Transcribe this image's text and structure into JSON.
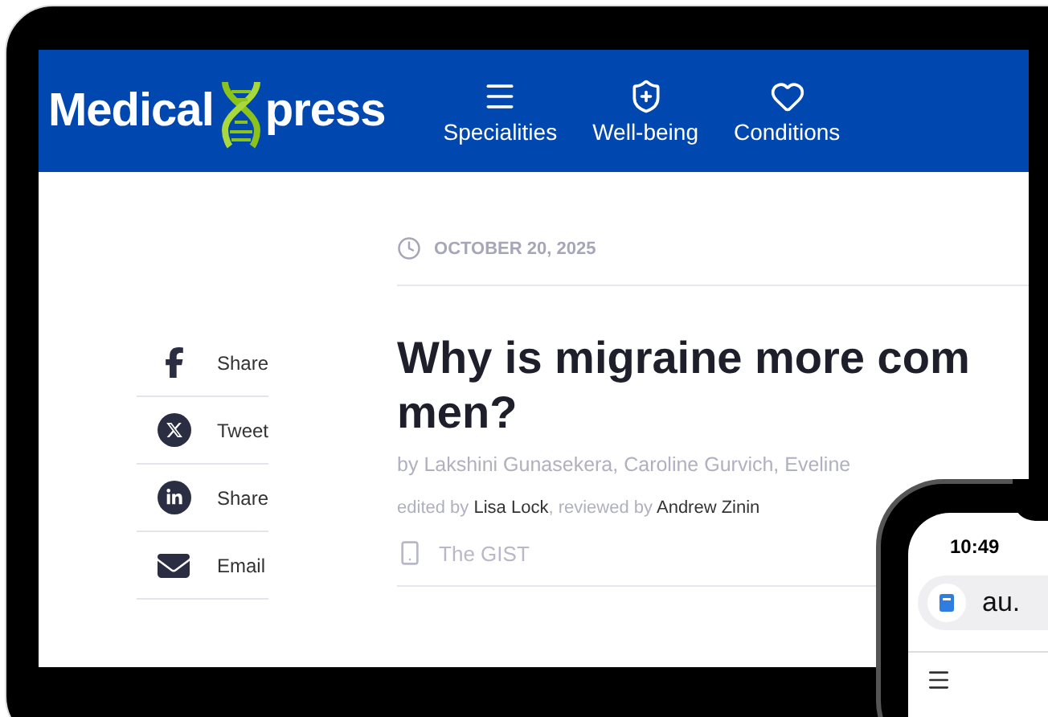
{
  "site": {
    "logo": {
      "left": "Medical",
      "right": "press"
    },
    "nav": [
      {
        "kind": "menu",
        "label": "Specialities"
      },
      {
        "kind": "shield",
        "label": "Well-being"
      },
      {
        "kind": "heart",
        "label": "Conditions"
      }
    ]
  },
  "share": [
    {
      "kind": "facebook",
      "label": "Share"
    },
    {
      "kind": "x",
      "label": "Tweet"
    },
    {
      "kind": "linkedin",
      "label": "Share"
    },
    {
      "kind": "email",
      "label": "Email"
    }
  ],
  "article": {
    "date": "OCTOBER 20, 2025",
    "title_lines": [
      "Why is migraine more com",
      "men?"
    ],
    "byline": "by Lakshini Gunasekera, Caroline Gurvich, Eveline",
    "edited": "edited by **Lisa Lock**, reviewed by **Andrew Zinin**",
    "gist": "The GIST"
  },
  "phone": {
    "time": "10:49",
    "url": "au."
  }
}
